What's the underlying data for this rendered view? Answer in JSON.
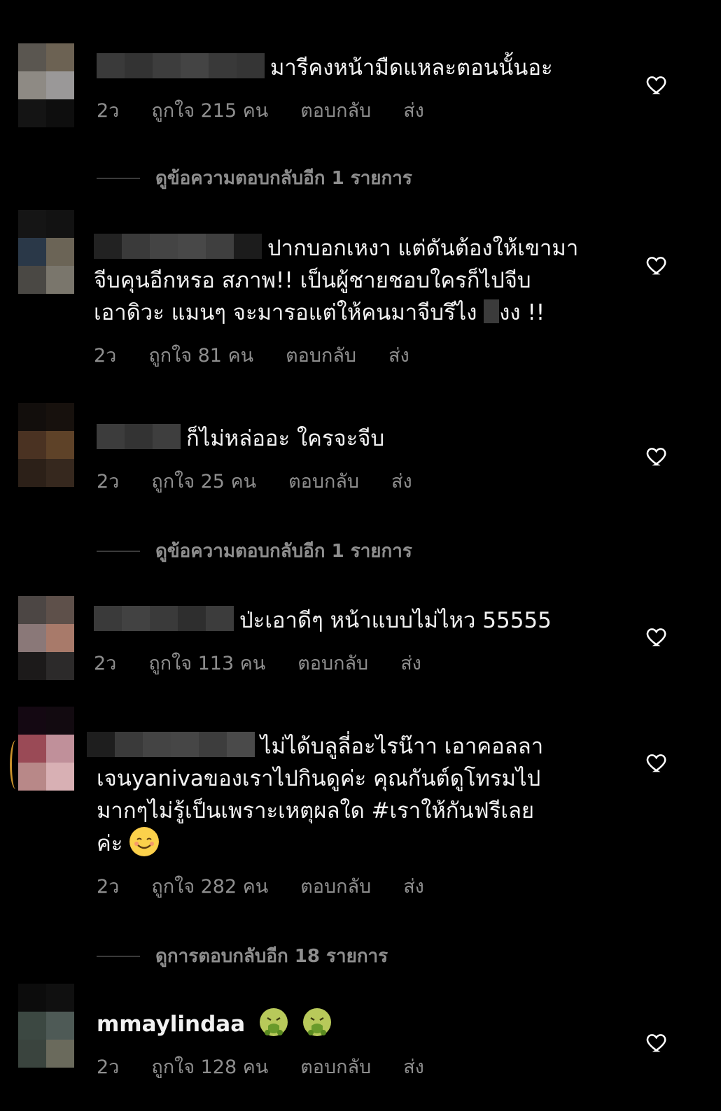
{
  "comments": [
    {
      "text": "มารีคงหน้ามืดแหละตอนนั้นอะ",
      "time": "2ว",
      "likes": "ถูกใจ 215 คน",
      "reply": "ตอบกลับ",
      "send": "ส่ง",
      "avatar_colors": [
        "#5a5650",
        "#6c6253",
        "#8e8a84",
        "#9a9898",
        "#141414",
        "#0e0e0e"
      ],
      "username_blur": [
        "#3a3a3a",
        "#333",
        "#3d3d3d",
        "#444",
        "#393939",
        "#353535"
      ]
    },
    {
      "text_lines": [
        "ปากบอกเหงา แต่ดันต้องให้เขามา",
        "จีบคุนอีกหรอ สภาพ!! เป็นผู้ชายชอบใครก็ไปจีบ",
        "เอาดิวะ แมนๆ จะมารอแต่ให้คนมาจีบรึไง",
        "งง !!"
      ],
      "time": "2ว",
      "likes": "ถูกใจ 81 คน",
      "reply": "ตอบกลับ",
      "send": "ส่ง",
      "avatar_colors": [
        "#151515",
        "#121212",
        "#2a3848",
        "#6b6456",
        "#4a4844",
        "#7a766c"
      ],
      "username_blur": [
        "#222",
        "#3a3a3a",
        "#444",
        "#484848",
        "#3f3f3f",
        "#1c1c1c"
      ]
    },
    {
      "text": "ก็ไม่หล่ออะ ใครจะจีบ",
      "time": "2ว",
      "likes": "ถูกใจ 25 คน",
      "reply": "ตอบกลับ",
      "send": "ส่ง",
      "avatar_colors": [
        "#120e0c",
        "#17110d",
        "#4a3222",
        "#5e4228",
        "#2c2018",
        "#36281e"
      ],
      "username_blur": [
        "#3c3c3c",
        "#333",
        "#3e3e3e"
      ]
    },
    {
      "text": "ป่ะเอาดีๆ หน้าแบบไม่ไหว 55555",
      "time": "2ว",
      "likes": "ถูกใจ 113 คน",
      "reply": "ตอบกลับ",
      "send": "ส่ง",
      "avatar_colors": [
        "#4c4644",
        "#5e504a",
        "#8a7878",
        "#a87a6a",
        "#1c1a1a",
        "#2c2a2a"
      ],
      "username_blur": [
        "#3a3a3a",
        "#424242",
        "#3a3a3a",
        "#2e2e2e",
        "#3c3c3c"
      ]
    },
    {
      "text_lines": [
        "ไม่ได้บลูลี่อะไรน๊าา เอาคอลลา",
        "เจนyanivaของเราไปกินดูค่ะ คุณกันต์ดูโทรมไป",
        "มากๆไม่รู้เป็นเพราะเหตุผลใด #เราให้กันฟรีเลย",
        "ค่ะ"
      ],
      "time": "2ว",
      "likes": "ถูกใจ 282 คน",
      "reply": "ตอบกลับ",
      "send": "ส่ง",
      "avatar_colors": [
        "#140812",
        "#120a10",
        "#9a4a56",
        "#c0909a",
        "#b88888",
        "#d8b0b4"
      ],
      "username_blur": [
        "#1e1e1e",
        "#3a3a3a",
        "#444",
        "#464646",
        "#3d3d3d",
        "#4a4a4a"
      ]
    },
    {
      "username": "mmaylindaa",
      "time": "2ว",
      "likes": "ถูกใจ 128 คน",
      "reply": "ตอบกลับ",
      "send": "ส่ง",
      "avatar_colors": [
        "#0c0c0c",
        "#101010",
        "#3c4842",
        "#4e5a56",
        "#3a443e",
        "#6a6a5c"
      ]
    }
  ],
  "view_replies": [
    "ดูข้อความตอบกลับอีก 1 รายการ",
    "ดูข้อความตอบกลับอีก 1 รายการ",
    "ดูการตอบกลับอีก 18 รายการ"
  ],
  "colors": {
    "background": "#000000",
    "meta_text": "#8e8e8e",
    "body_text": "#f2f2f2",
    "story_ring": "#c8902a"
  }
}
